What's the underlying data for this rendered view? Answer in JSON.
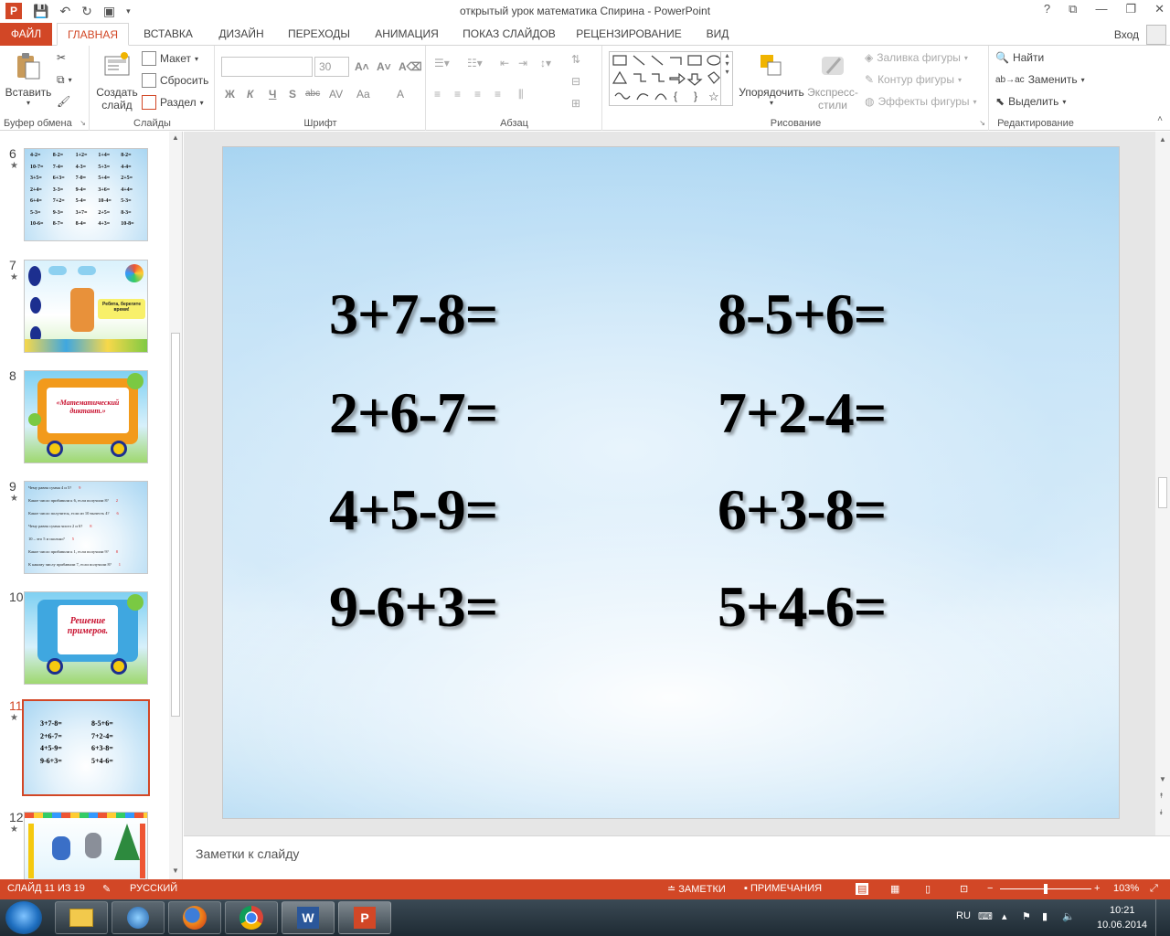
{
  "window": {
    "title": "открытый урок математика Спирина - PowerPoint",
    "buttons": [
      "?",
      "⧉",
      "—",
      "❐",
      "✕"
    ]
  },
  "tabs": {
    "file": "ФАЙЛ",
    "items": [
      "ГЛАВНАЯ",
      "ВСТАВКА",
      "ДИЗАЙН",
      "ПЕРЕХОДЫ",
      "АНИМАЦИЯ",
      "ПОКАЗ СЛАЙДОВ",
      "РЕЦЕНЗИРОВАНИЕ",
      "ВИД"
    ],
    "active": "ГЛАВНАЯ",
    "signin": "Вход"
  },
  "ribbon": {
    "clipboard": {
      "paste": "Вставить",
      "label": "Буфер обмена"
    },
    "slides": {
      "new_slide_1": "Создать",
      "new_slide_2": "слайд",
      "layout": "Макет",
      "reset": "Сбросить",
      "section": "Раздел",
      "label": "Слайды"
    },
    "font": {
      "size": "30",
      "bold": "Ж",
      "italic": "К",
      "underline": "Ч",
      "shadow": "S",
      "strike": "abc",
      "spacing": "AV",
      "case": "Aa",
      "color": "A",
      "label": "Шрифт"
    },
    "paragraph": {
      "label": "Абзац"
    },
    "drawing": {
      "arrange": "Упорядочить",
      "quick_1": "Экспресс-",
      "quick_2": "стили",
      "fill": "Заливка фигуры",
      "outline": "Контур фигуры",
      "effects": "Эффекты фигуры",
      "label": "Рисование"
    },
    "editing": {
      "find": "Найти",
      "replace": "Заменить",
      "select": "Выделить",
      "label": "Редактирование"
    }
  },
  "thumbnails": [
    {
      "num": "6",
      "star": "★",
      "rows": [
        [
          "4-2=",
          "8-2=",
          "1+2=",
          "1+4=",
          "8-2="
        ],
        [
          "10-7=",
          "7-4=",
          "4-3=",
          "5+3=",
          "4-4="
        ],
        [
          "3+5=",
          "6+3=",
          "7-0=",
          "5+4=",
          "2+5="
        ],
        [
          "2+4=",
          "3-3=",
          "9-4=",
          "3+6=",
          "4+4="
        ],
        [
          "6+4=",
          "7+2=",
          "5-4=",
          "10-4=",
          "5-3="
        ],
        [
          "5-3=",
          "9-3=",
          "3+7=",
          "2+5=",
          "8-3="
        ],
        [
          "10-6=",
          "8-7=",
          "8-4=",
          "4+3=",
          "10-8="
        ]
      ]
    },
    {
      "num": "7",
      "star": "★",
      "caption": "Ребята, берегите время!"
    },
    {
      "num": "8",
      "caption": "«Математический диктант.»"
    },
    {
      "num": "9",
      "star": "★",
      "lines": [
        "Чему равна сумма 4 и 5?",
        "Какое число прибавили к 6, если получили 8?",
        "Какое число получится, если из 10 вычесть 4?",
        "Чему равна сумма чисел 2 и 6?",
        "10 – это 5 и сколько?",
        "Какое число прибавили к 1, если получили 9?",
        "К какому числу прибавили 7, если получили 8?"
      ],
      "answers": [
        "9",
        "2",
        "6",
        "8",
        "5",
        "8",
        "1"
      ]
    },
    {
      "num": "10",
      "caption": "Решение примеров."
    },
    {
      "num": "11",
      "star": "★",
      "selected": true,
      "left": [
        "3+7-8=",
        "2+6-7=",
        "4+5-9=",
        "9-6+3="
      ],
      "right": [
        "8-5+6=",
        "7+2-4=",
        "6+3-8=",
        "5+4-6="
      ]
    },
    {
      "num": "12",
      "star": "★"
    }
  ],
  "slide": {
    "left": [
      "3+7-8=",
      "2+6-7=",
      "4+5-9=",
      "9-6+3="
    ],
    "right": [
      "8-5+6=",
      "7+2-4=",
      "6+3-8=",
      "5+4-6="
    ]
  },
  "notes": {
    "placeholder": "Заметки к слайду"
  },
  "status": {
    "slide": "СЛАЙД 11 ИЗ 19",
    "language": "РУССКИЙ",
    "notes": "ЗАМЕТКИ",
    "comments": "ПРИМЕЧАНИЯ",
    "zoom": "103%",
    "zoom_level": 0.5
  },
  "taskbar": {
    "lang": "RU",
    "time": "10:21",
    "date": "10.06.2014",
    "apps": [
      "explorer",
      "media-player",
      "firefox",
      "chrome",
      "word",
      "powerpoint"
    ]
  },
  "colors": {
    "accent": "#d24726",
    "slide_sky": "#a7d4f1"
  }
}
